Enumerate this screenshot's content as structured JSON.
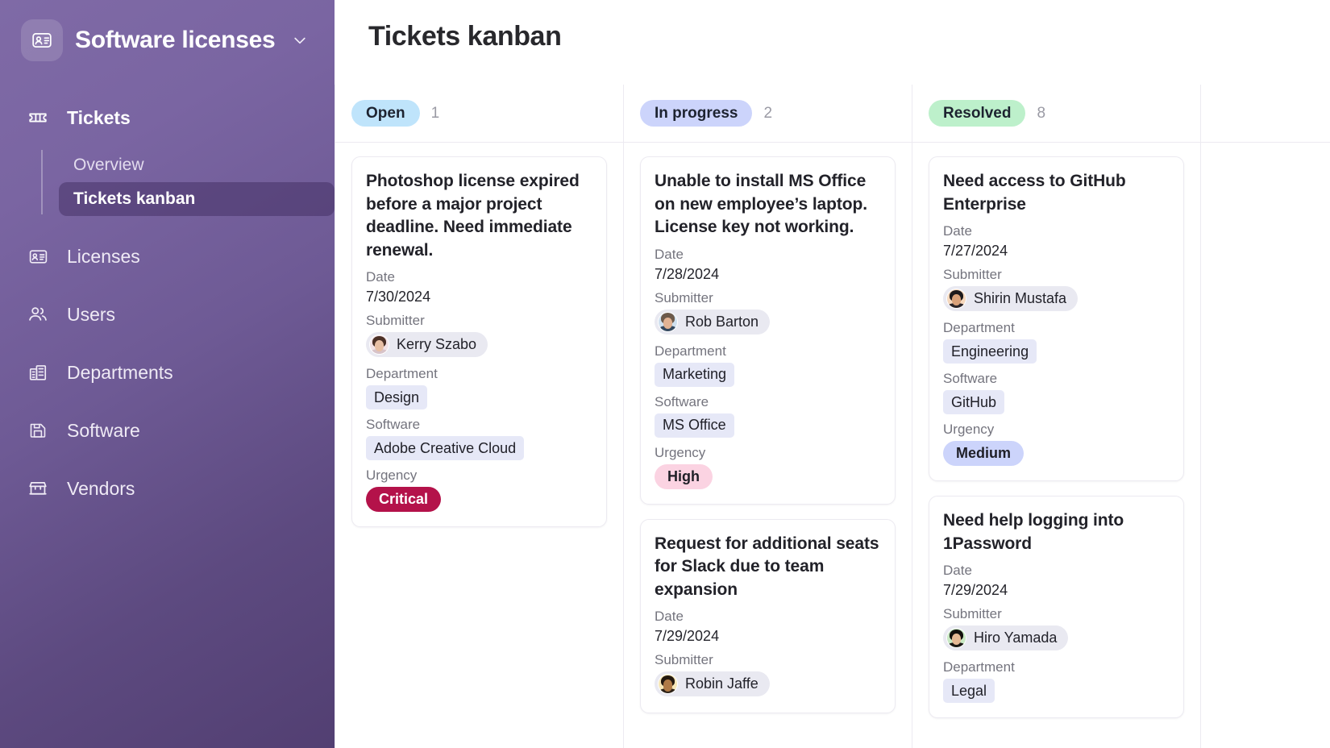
{
  "sidebar": {
    "brand": {
      "name": "Software licenses",
      "logo_icon": "contact-card-icon",
      "caret_icon": "chevron-down-icon"
    },
    "nav": [
      {
        "label": "Tickets",
        "icon": "ticket-icon",
        "active": true
      },
      {
        "label": "Licenses",
        "icon": "license-card-icon",
        "active": false
      },
      {
        "label": "Users",
        "icon": "users-icon",
        "active": false
      },
      {
        "label": "Departments",
        "icon": "building-icon",
        "active": false
      },
      {
        "label": "Software",
        "icon": "floppy-disk-icon",
        "active": false
      },
      {
        "label": "Vendors",
        "icon": "storefront-icon",
        "active": false
      }
    ],
    "subnav": [
      {
        "label": "Overview",
        "active": false
      },
      {
        "label": "Tickets kanban",
        "active": true
      }
    ]
  },
  "main": {
    "title": "Tickets kanban",
    "field_labels": {
      "date": "Date",
      "submitter": "Submitter",
      "department": "Department",
      "software": "Software",
      "urgency": "Urgency"
    },
    "columns": [
      {
        "status": "Open",
        "count": "1",
        "pill_bg": "#bfe4fb",
        "cards": [
          {
            "title": "Photoshop license expired before a major project deadline. Need immediate renewal.",
            "date": "7/30/2024",
            "submitter": "Kerry Szabo",
            "department": "Design",
            "software": "Adobe Creative Cloud",
            "urgency": "Critical",
            "urgency_bg": "#b4124a",
            "urgency_fg": "#ffffff",
            "avatar_hair": "#4b3026",
            "avatar_skin": "#e8bfa4",
            "avatar_bg": "#f3e2e6",
            "avatar_body": "#d7c3c9"
          }
        ]
      },
      {
        "status": "In progress",
        "count": "2",
        "pill_bg": "#ccd4fb",
        "cards": [
          {
            "title": "Unable to install MS Office on new employee’s laptop. License key not working.",
            "date": "7/28/2024",
            "submitter": "Rob Barton",
            "department": "Marketing",
            "software": "MS Office",
            "urgency": "High",
            "urgency_bg": "#fbd3e2",
            "urgency_fg": "#1f1f27",
            "avatar_hair": "#6d5a4b",
            "avatar_skin": "#e2b394",
            "avatar_bg": "#cfe0ef",
            "avatar_body": "#34485e"
          },
          {
            "title": "Request for additional seats for Slack due to team expansion",
            "date": "7/29/2024",
            "submitter": "Robin Jaffe",
            "department": "",
            "software": "",
            "urgency": "",
            "urgency_bg": "",
            "urgency_fg": "",
            "avatar_hair": "#23180f",
            "avatar_skin": "#b07a46",
            "avatar_bg": "#f7e7b8",
            "avatar_body": "#2c2118"
          }
        ]
      },
      {
        "status": "Resolved",
        "count": "8",
        "pill_bg": "#bdf0cb",
        "cards": [
          {
            "title": "Need access to GitHub Enterprise",
            "date": "7/27/2024",
            "submitter": "Shirin Mustafa",
            "department": "Engineering",
            "software": "GitHub",
            "urgency": "Medium",
            "urgency_bg": "#ccd4fb",
            "urgency_fg": "#1f1f27",
            "avatar_hair": "#1d1a1c",
            "avatar_skin": "#d9a179",
            "avatar_bg": "#f6d8bd",
            "avatar_body": "#2a2428"
          },
          {
            "title": "Need help logging into 1Password",
            "date": "7/29/2024",
            "submitter": "Hiro Yamada",
            "department": "Legal",
            "software": "",
            "urgency": "",
            "urgency_bg": "",
            "urgency_fg": "",
            "avatar_hair": "#14100e",
            "avatar_skin": "#e5b894",
            "avatar_bg": "#c8e8c3",
            "avatar_body": "#1b1613"
          }
        ]
      },
      {
        "status": "",
        "count": "",
        "pill_bg": "",
        "cards": []
      }
    ]
  }
}
